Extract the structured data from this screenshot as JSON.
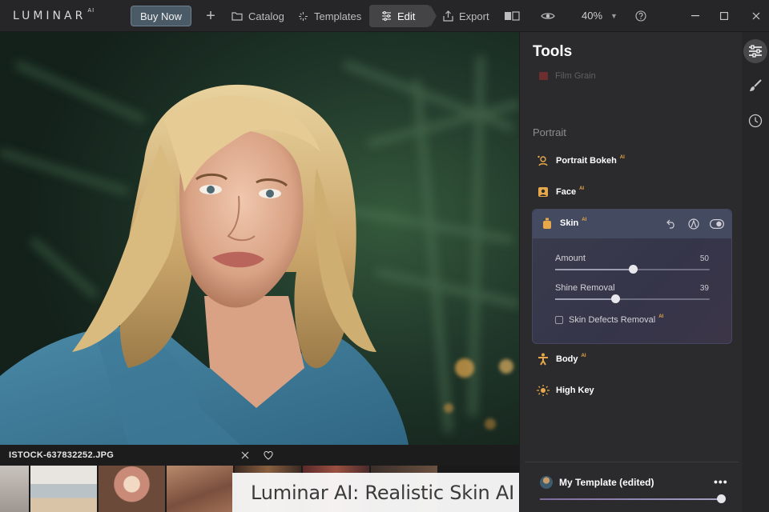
{
  "app": {
    "logo": "LUMINAR",
    "logo_sup": "AI"
  },
  "topbar": {
    "buy_label": "Buy Now",
    "catalog_label": "Catalog",
    "templates_label": "Templates",
    "edit_label": "Edit",
    "export_label": "Export",
    "zoom": "40%"
  },
  "filmstrip": {
    "filename": "ISTOCK-637832252.JPG"
  },
  "caption": "Luminar AI: Realistic Skin AI",
  "panel": {
    "title": "Tools",
    "faded_tool": "Film Grain",
    "section": "Portrait",
    "tools": {
      "portrait_bokeh": "Portrait Bokeh",
      "face": "Face",
      "skin": "Skin",
      "body": "Body",
      "high_key": "High Key",
      "ai_badge": "AI"
    },
    "skin": {
      "amount_label": "Amount",
      "amount_value": "50",
      "amount_level": 0.5,
      "shine_label": "Shine Removal",
      "shine_value": "39",
      "shine_level": 0.39,
      "defects_label": "Skin Defects Removal"
    },
    "template": {
      "name": "My Template (edited)",
      "more": "•••",
      "level": 1.0
    }
  },
  "colors": {
    "accent_ai": "#e6a84a",
    "skin_card": "#3a3c4c",
    "buy_button": "#4a5a66"
  }
}
